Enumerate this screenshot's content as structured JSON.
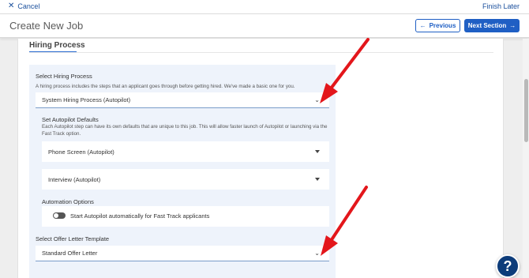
{
  "topbar": {
    "cancel_label": "Cancel",
    "finish_label": "Finish Later"
  },
  "header": {
    "title": "Create New Job",
    "previous_label": "Previous",
    "next_label": "Next Section"
  },
  "section": {
    "title": "Hiring Process"
  },
  "hiring_process": {
    "label": "Select Hiring Process",
    "help": "A hiring process includes the steps that an applicant goes through before getting hired. We've made a basic one for you.",
    "value": "System Hiring Process (Autopilot)"
  },
  "autopilot": {
    "label": "Set Autopilot Defaults",
    "help": "Each Autopilot step can have its own defaults that are unique to this job. This will allow faster launch of Autopilot or launching via the Fast Track option.",
    "steps": [
      "Phone Screen (Autopilot)",
      "Interview (Autopilot)"
    ]
  },
  "automation": {
    "label": "Automation Options",
    "toggle_label": "Start Autopilot automatically for Fast Track applicants",
    "toggle_on": false
  },
  "offer_letter": {
    "label": "Select Offer Letter Template",
    "value": "Standard Offer Letter"
  },
  "help_button": {
    "glyph": "?"
  },
  "colors": {
    "accent": "#1f5fc4",
    "annotation_arrow": "#e3161b",
    "panel": "#eef3fb",
    "fab": "#0d3c7a"
  }
}
